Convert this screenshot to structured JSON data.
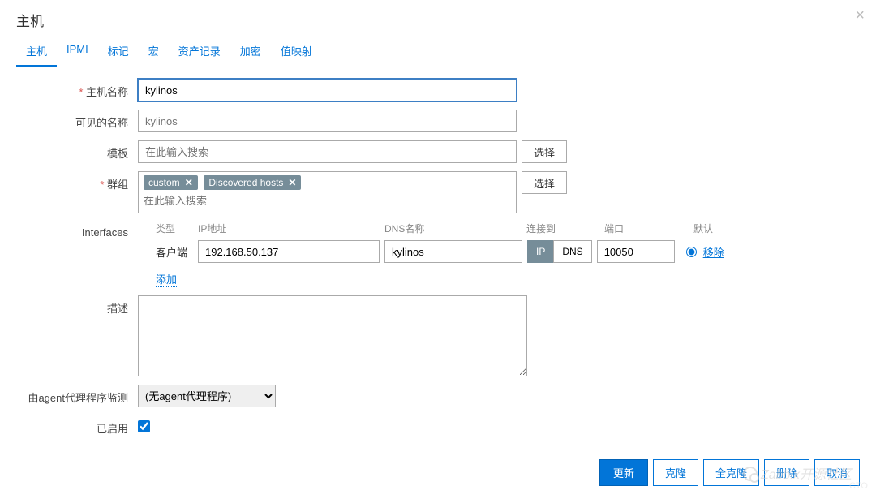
{
  "header": {
    "title": "主机"
  },
  "tabs": [
    "主机",
    "IPMI",
    "标记",
    "宏",
    "资产记录",
    "加密",
    "值映射"
  ],
  "active_tab_index": 0,
  "labels": {
    "host_name": "主机名称",
    "visible_name": "可见的名称",
    "templates": "模板",
    "groups": "群组",
    "interfaces": "Interfaces",
    "description": "描述",
    "proxy": "由agent代理程序监测",
    "enabled": "已启用"
  },
  "fields": {
    "host_name": "kylinos",
    "visible_name_placeholder": "kylinos",
    "templates_placeholder": "在此输入搜索",
    "groups_placeholder": "在此输入搜索",
    "description": "",
    "enabled": true,
    "proxy_selected": "(无agent代理程序)"
  },
  "group_tags": [
    {
      "label": "custom"
    },
    {
      "label": "Discovered hosts"
    }
  ],
  "buttons": {
    "select": "选择",
    "add_link": "添加",
    "remove_link": "移除"
  },
  "interface_headers": {
    "type": "类型",
    "ip": "IP地址",
    "dns": "DNS名称",
    "connect": "连接到",
    "port": "端口",
    "default": "默认"
  },
  "interfaces": [
    {
      "type": "客户端",
      "ip": "192.168.50.137",
      "dns": "kylinos",
      "connect_ip": "IP",
      "connect_dns": "DNS",
      "connect_active": "ip",
      "port": "10050",
      "default": true
    }
  ],
  "footer": {
    "update": "更新",
    "clone": "克隆",
    "full_clone": "全克隆",
    "delete": "删除",
    "cancel": "取消"
  },
  "watermark": "Zabbix开源社区",
  "watermark2": "CTO"
}
